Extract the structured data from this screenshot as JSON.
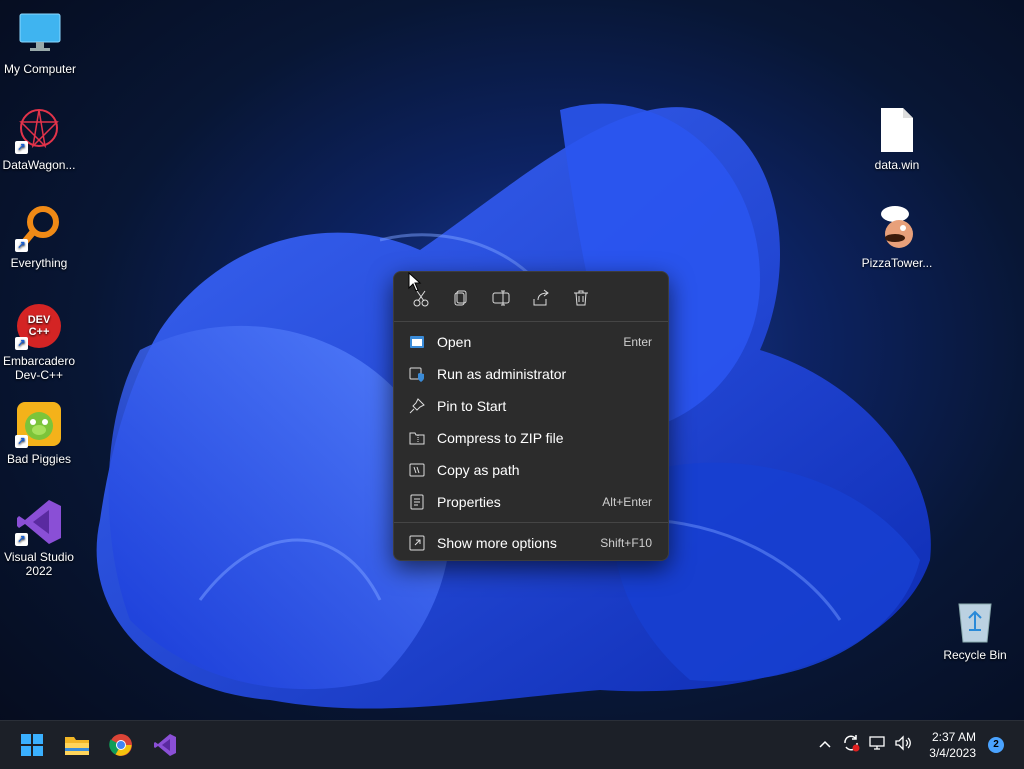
{
  "desktop": {
    "icons": [
      {
        "label": "My Computer",
        "icon": "monitor-icon"
      },
      {
        "label": "DataWagon...",
        "icon": "datawagon-icon"
      },
      {
        "label": "Everything",
        "icon": "everything-search-icon"
      },
      {
        "label": "Embarcadero Dev-C++",
        "icon": "devcpp-icon",
        "badge": "DEV C++"
      },
      {
        "label": "Bad Piggies",
        "icon": "bad-piggies-icon"
      },
      {
        "label": "Visual Studio 2022",
        "icon": "visual-studio-icon"
      },
      {
        "label": "data.win",
        "icon": "file-icon"
      },
      {
        "label": "PizzaTower...",
        "icon": "pizza-tower-icon"
      },
      {
        "label": "Recycle Bin",
        "icon": "recycle-bin-icon"
      }
    ]
  },
  "context_menu": {
    "toolbar": [
      {
        "name": "cut",
        "icon": "scissors-icon"
      },
      {
        "name": "copy",
        "icon": "copy-icon"
      },
      {
        "name": "rename",
        "icon": "rename-icon"
      },
      {
        "name": "share",
        "icon": "share-icon"
      },
      {
        "name": "delete",
        "icon": "trash-icon"
      }
    ],
    "items": [
      {
        "label": "Open",
        "shortcut": "Enter",
        "icon": "open-icon"
      },
      {
        "label": "Run as administrator",
        "shortcut": "",
        "icon": "shield-icon"
      },
      {
        "label": "Pin to Start",
        "shortcut": "",
        "icon": "pin-icon"
      },
      {
        "label": "Compress to ZIP file",
        "shortcut": "",
        "icon": "zip-folder-icon"
      },
      {
        "label": "Copy as path",
        "shortcut": "",
        "icon": "copy-path-icon"
      },
      {
        "label": "Properties",
        "shortcut": "Alt+Enter",
        "icon": "properties-icon"
      },
      {
        "label": "Show more options",
        "shortcut": "Shift+F10",
        "icon": "more-options-icon"
      }
    ]
  },
  "taskbar": {
    "apps": [
      "start-icon",
      "file-explorer-icon",
      "chrome-icon",
      "visual-studio-icon"
    ],
    "tray": [
      "chevron-up-icon",
      "sync-icon",
      "network-icon",
      "volume-icon"
    ],
    "time": "2:37 AM",
    "date": "3/4/2023",
    "notification_count": "2"
  },
  "colors": {
    "menu_bg": "#2c2c2c",
    "taskbar_bg": "#1c2028",
    "accent": "#4aa3ff"
  }
}
